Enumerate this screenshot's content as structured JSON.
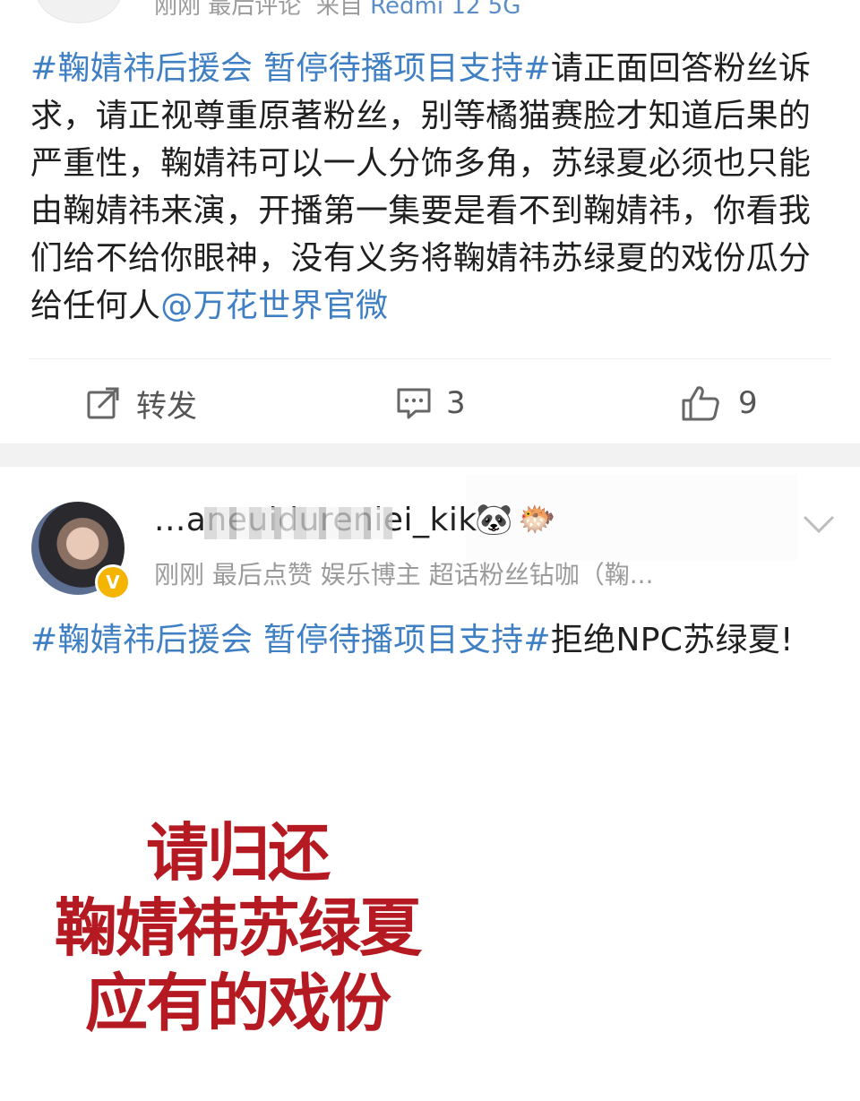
{
  "post1": {
    "meta": {
      "time": "刚刚",
      "last_action": "最后评论",
      "source_prefix": "来自",
      "device": "Redmi 12 5G"
    },
    "text": {
      "tag": "#鞠婧祎后援会 暂停待播项目支持#",
      "body": "请正面回答粉丝诉求，请正视尊重原著粉丝，别等橘猫赛脸才知道后果的严重性，鞠婧祎可以一人分饰多角，苏绿夏必须也只能由鞠婧祎来演，开播第一集要是看不到鞠婧祎，你看我们给不给你眼神，没有义务将鞠婧祎苏绿夏的戏份瓜分给任何人",
      "mention": "@万花世界官微"
    },
    "actions": {
      "repost_label": "转发",
      "comment_count": "3",
      "like_count": "9"
    }
  },
  "post2": {
    "username": "...aneuidureniei_kiku",
    "badges": [
      "panda-icon",
      "pufferfish-icon"
    ],
    "meta": "刚刚  最后点赞  娱乐博主 超话粉丝钻咖（鞠...",
    "text": {
      "tag": "#鞠婧祎后援会 暂停待播项目支持#",
      "body": "拒绝NPC苏绿夏!"
    },
    "image_text": [
      "请归还",
      "鞠婧祎苏绿夏",
      "应有的戏份"
    ]
  },
  "colors": {
    "link": "#3f7fc3",
    "image_text": "#b51a22",
    "meta": "#9b9b9b",
    "verified": "#f5b400"
  }
}
